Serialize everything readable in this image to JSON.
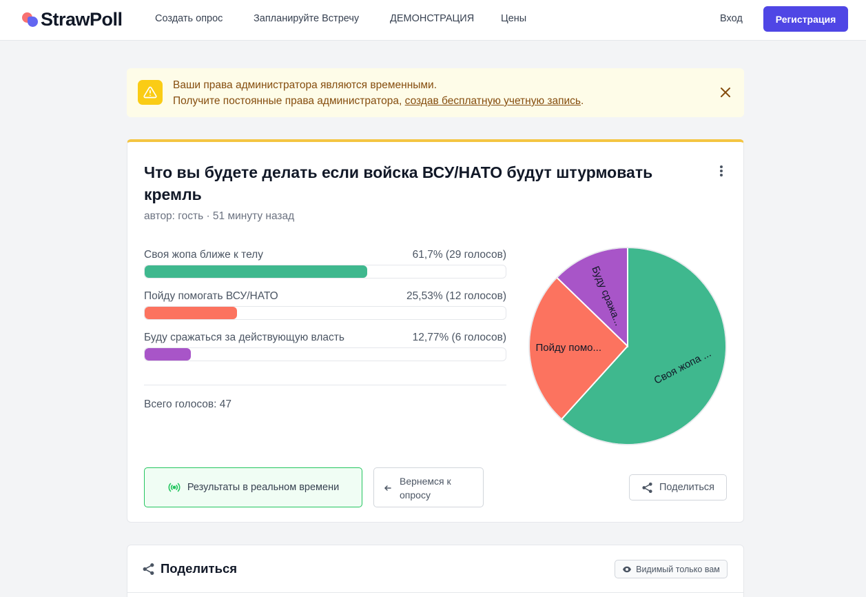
{
  "header": {
    "brand": "StrawPoll",
    "nav": [
      "Создать опрос",
      "Запланируйте Встречу",
      "ДЕМОНСТРАЦИЯ",
      "Цены"
    ],
    "login": "Вход",
    "register": "Регистрация"
  },
  "alert": {
    "icon": "warning-icon",
    "line1": "Ваши права администратора являются временными.",
    "line2_prefix": "Получите постоянные права администратора, ",
    "line2_link": "создав бесплатную учетную запись",
    "line2_suffix": ".",
    "color": "#facc15"
  },
  "poll": {
    "title": "Что вы будете делать если войска ВСУ/НАТО будут штурмовать кремль",
    "meta": "автор: гость · 51 минуту назад",
    "options": [
      {
        "label": "Своя жопа ближе к телу",
        "value": "61,7% (29 голосов)",
        "percent": 61.7,
        "color": "#3fb88e"
      },
      {
        "label": "Пойду помогать ВСУ/НАТО",
        "value": "25,53% (12 голосов)",
        "percent": 25.53,
        "color": "#fc735f"
      },
      {
        "label": "Буду сражаться за действующую власть",
        "value": "12,77% (6 голосов)",
        "percent": 12.77,
        "color": "#a855c8"
      }
    ],
    "total": "Всего голосов: 47",
    "pie_labels": [
      "Своя жопа ...",
      "Пойду помо...",
      "Буду сража..."
    ],
    "live_button": "Результаты в реальном времени",
    "back_button": "Вернемся к опросу",
    "share_button": "Поделиться"
  },
  "chart_data": {
    "type": "pie",
    "categories": [
      "Своя жопа ближе к телу",
      "Пойду помогать ВСУ/НАТО",
      "Буду сражаться за действующую власть"
    ],
    "values": [
      29,
      12,
      6
    ],
    "colors": [
      "#3fb88e",
      "#fc735f",
      "#a855c8"
    ]
  },
  "share_section": {
    "title": "Поделиться",
    "badge": "Видимый только вам"
  },
  "colors": {
    "accent": "#4f46e5",
    "poll_top_border": "#f4c542"
  }
}
